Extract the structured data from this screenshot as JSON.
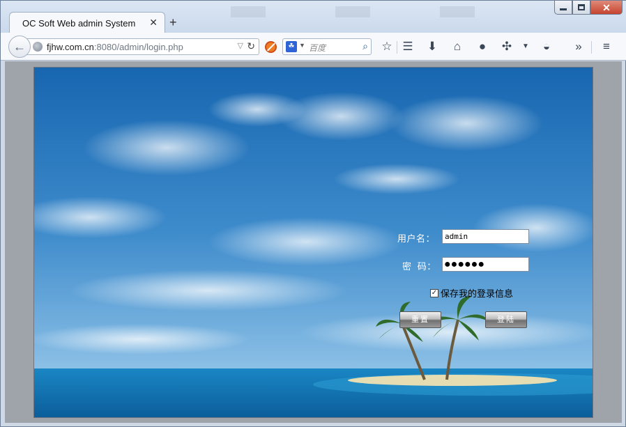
{
  "window": {
    "controls": {
      "minimize_icon": "minimize-icon",
      "maximize_icon": "maximize-icon",
      "close_icon": "close-icon"
    }
  },
  "tabs": [
    {
      "title": "OC Soft Web admin System",
      "close_glyph": "✕"
    }
  ],
  "new_tab_glyph": "+",
  "navbar": {
    "url_host": "fjhw.com.cn",
    "url_path": ":8080/admin/login.php",
    "search_placeholder": "百度",
    "search_engine_icon": "baidu-paw-icon",
    "toolbar_icons": [
      "bookmark-star-icon",
      "reading-list-icon",
      "download-icon",
      "home-icon",
      "chat-icon",
      "bug-icon",
      "dropdown-icon",
      "globe-menu-icon",
      "overflow-icon",
      "menu-icon"
    ]
  },
  "login": {
    "username_label": "用户名：",
    "username_value": "admin",
    "password_label": "密  码：",
    "password_mask": "●●●●●●",
    "remember_label": "保存我的登录信息",
    "remember_checked": true,
    "reset_button": "重置",
    "submit_button": "登陆"
  },
  "colors": {
    "sky_top": "#1f67ad",
    "sky_bottom": "#6ea9d8",
    "sea": "#1476b4",
    "sand": "#e4dcb0"
  }
}
